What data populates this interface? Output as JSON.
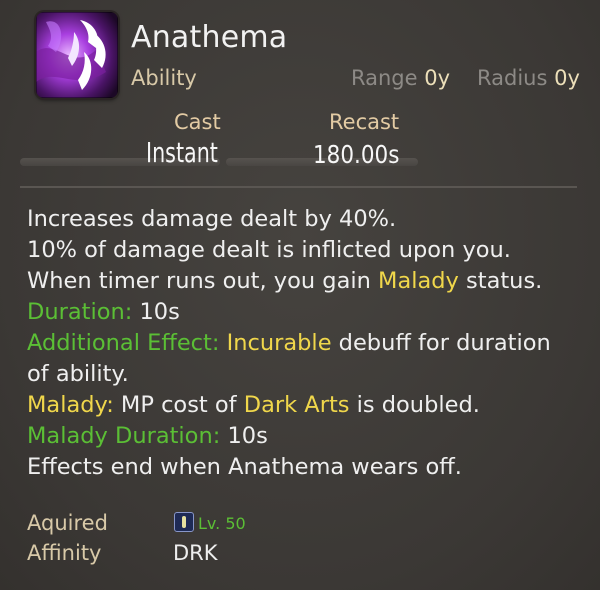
{
  "ability": {
    "name": "Anathema",
    "type": "Ability",
    "icon": "anathema-purple-claw-icon"
  },
  "stats": {
    "range_label": "Range",
    "range_value": "0y",
    "radius_label": "Radius",
    "radius_value": "0y",
    "cast_label": "Cast",
    "cast_value": "Instant",
    "recast_label": "Recast",
    "recast_value": "180.00s"
  },
  "description": {
    "line1": "Increases damage dealt by 40%.",
    "line2": "10% of damage dealt is inflicted upon you.",
    "line3_a": "When timer runs out, you gain ",
    "line3_b": "Malady",
    "line3_c": " status.",
    "duration_label": "Duration:",
    "duration_value": " 10s",
    "additional_label": "Additional Effect:",
    "additional_keyword": " Incurable",
    "additional_rest": " debuff for duration",
    "additional_cont": "of ability.",
    "malady_label": "Malady:",
    "malady_text_a": " MP cost of ",
    "malady_keyword": "Dark Arts",
    "malady_text_b": " is doubled.",
    "malady_duration_label": "Malady Duration:",
    "malady_duration_value": " 10s",
    "effects_end": "Effects end when Anathema wears off."
  },
  "meta": {
    "aquired_label": "Aquired",
    "level": "Lv. 50",
    "job_icon": "job-crystal-icon",
    "affinity_label": "Affinity",
    "affinity_value": "DRK"
  },
  "colors": {
    "background": "#3d3a37",
    "green_label": "#5bbf35",
    "yellow_keyword": "#f0d74b",
    "tan_label": "#d8c9a8"
  }
}
